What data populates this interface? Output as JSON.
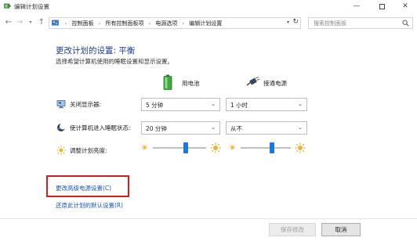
{
  "window": {
    "title": "编辑计划设置",
    "minimize_glyph": "—",
    "close_glyph": "✕"
  },
  "nav": {
    "back_glyph": "←",
    "forward_glyph": "→",
    "recent_glyph": "▾",
    "up_glyph": "↑",
    "breadcrumbs": [
      "控制面板",
      "所有控制面板项",
      "电源选项",
      "编辑计划设置"
    ],
    "crumb_separator": "›",
    "dropdown_glyph": "▾",
    "refresh_glyph": "↻",
    "search_placeholder": "搜索控制面板"
  },
  "main": {
    "title": "更改计划的设置: 平衡",
    "subtitle": "选择希望计算机使用的睡眠设置和显示设置。",
    "columns": {
      "battery": "用电池",
      "plugged": "接通电源"
    },
    "rows": {
      "display_off": {
        "label": "关闭显示器:",
        "battery_value": "5 分钟",
        "plugged_value": "1 小时"
      },
      "sleep": {
        "label": "使计算机进入睡眠状态:",
        "battery_value": "20 分钟",
        "plugged_value": "从不"
      },
      "brightness": {
        "label": "调整计划亮度:",
        "battery_level": 0.62,
        "plugged_level": 0.62
      }
    },
    "select_arrow": "⌄",
    "advanced_link": "更改高级电源设置(C)",
    "restore_link": "还原此计划的默认设置(R)"
  },
  "footer": {
    "save_label": "保存修改",
    "cancel_label": "取消"
  },
  "colors": {
    "title_blue": "#1e3a8a",
    "link_blue": "#1a55c0",
    "slider_blue": "#1e78d8",
    "highlight_red": "#d41e1e"
  },
  "icons": {
    "app": "power-options-icon",
    "address": "control-panel-icon",
    "battery": "battery-icon",
    "plug": "power-plug-icon",
    "display": "monitor-icon",
    "sleep": "moon-icon",
    "brightness_low": "sun-small-icon",
    "brightness_high": "sun-large-icon"
  }
}
